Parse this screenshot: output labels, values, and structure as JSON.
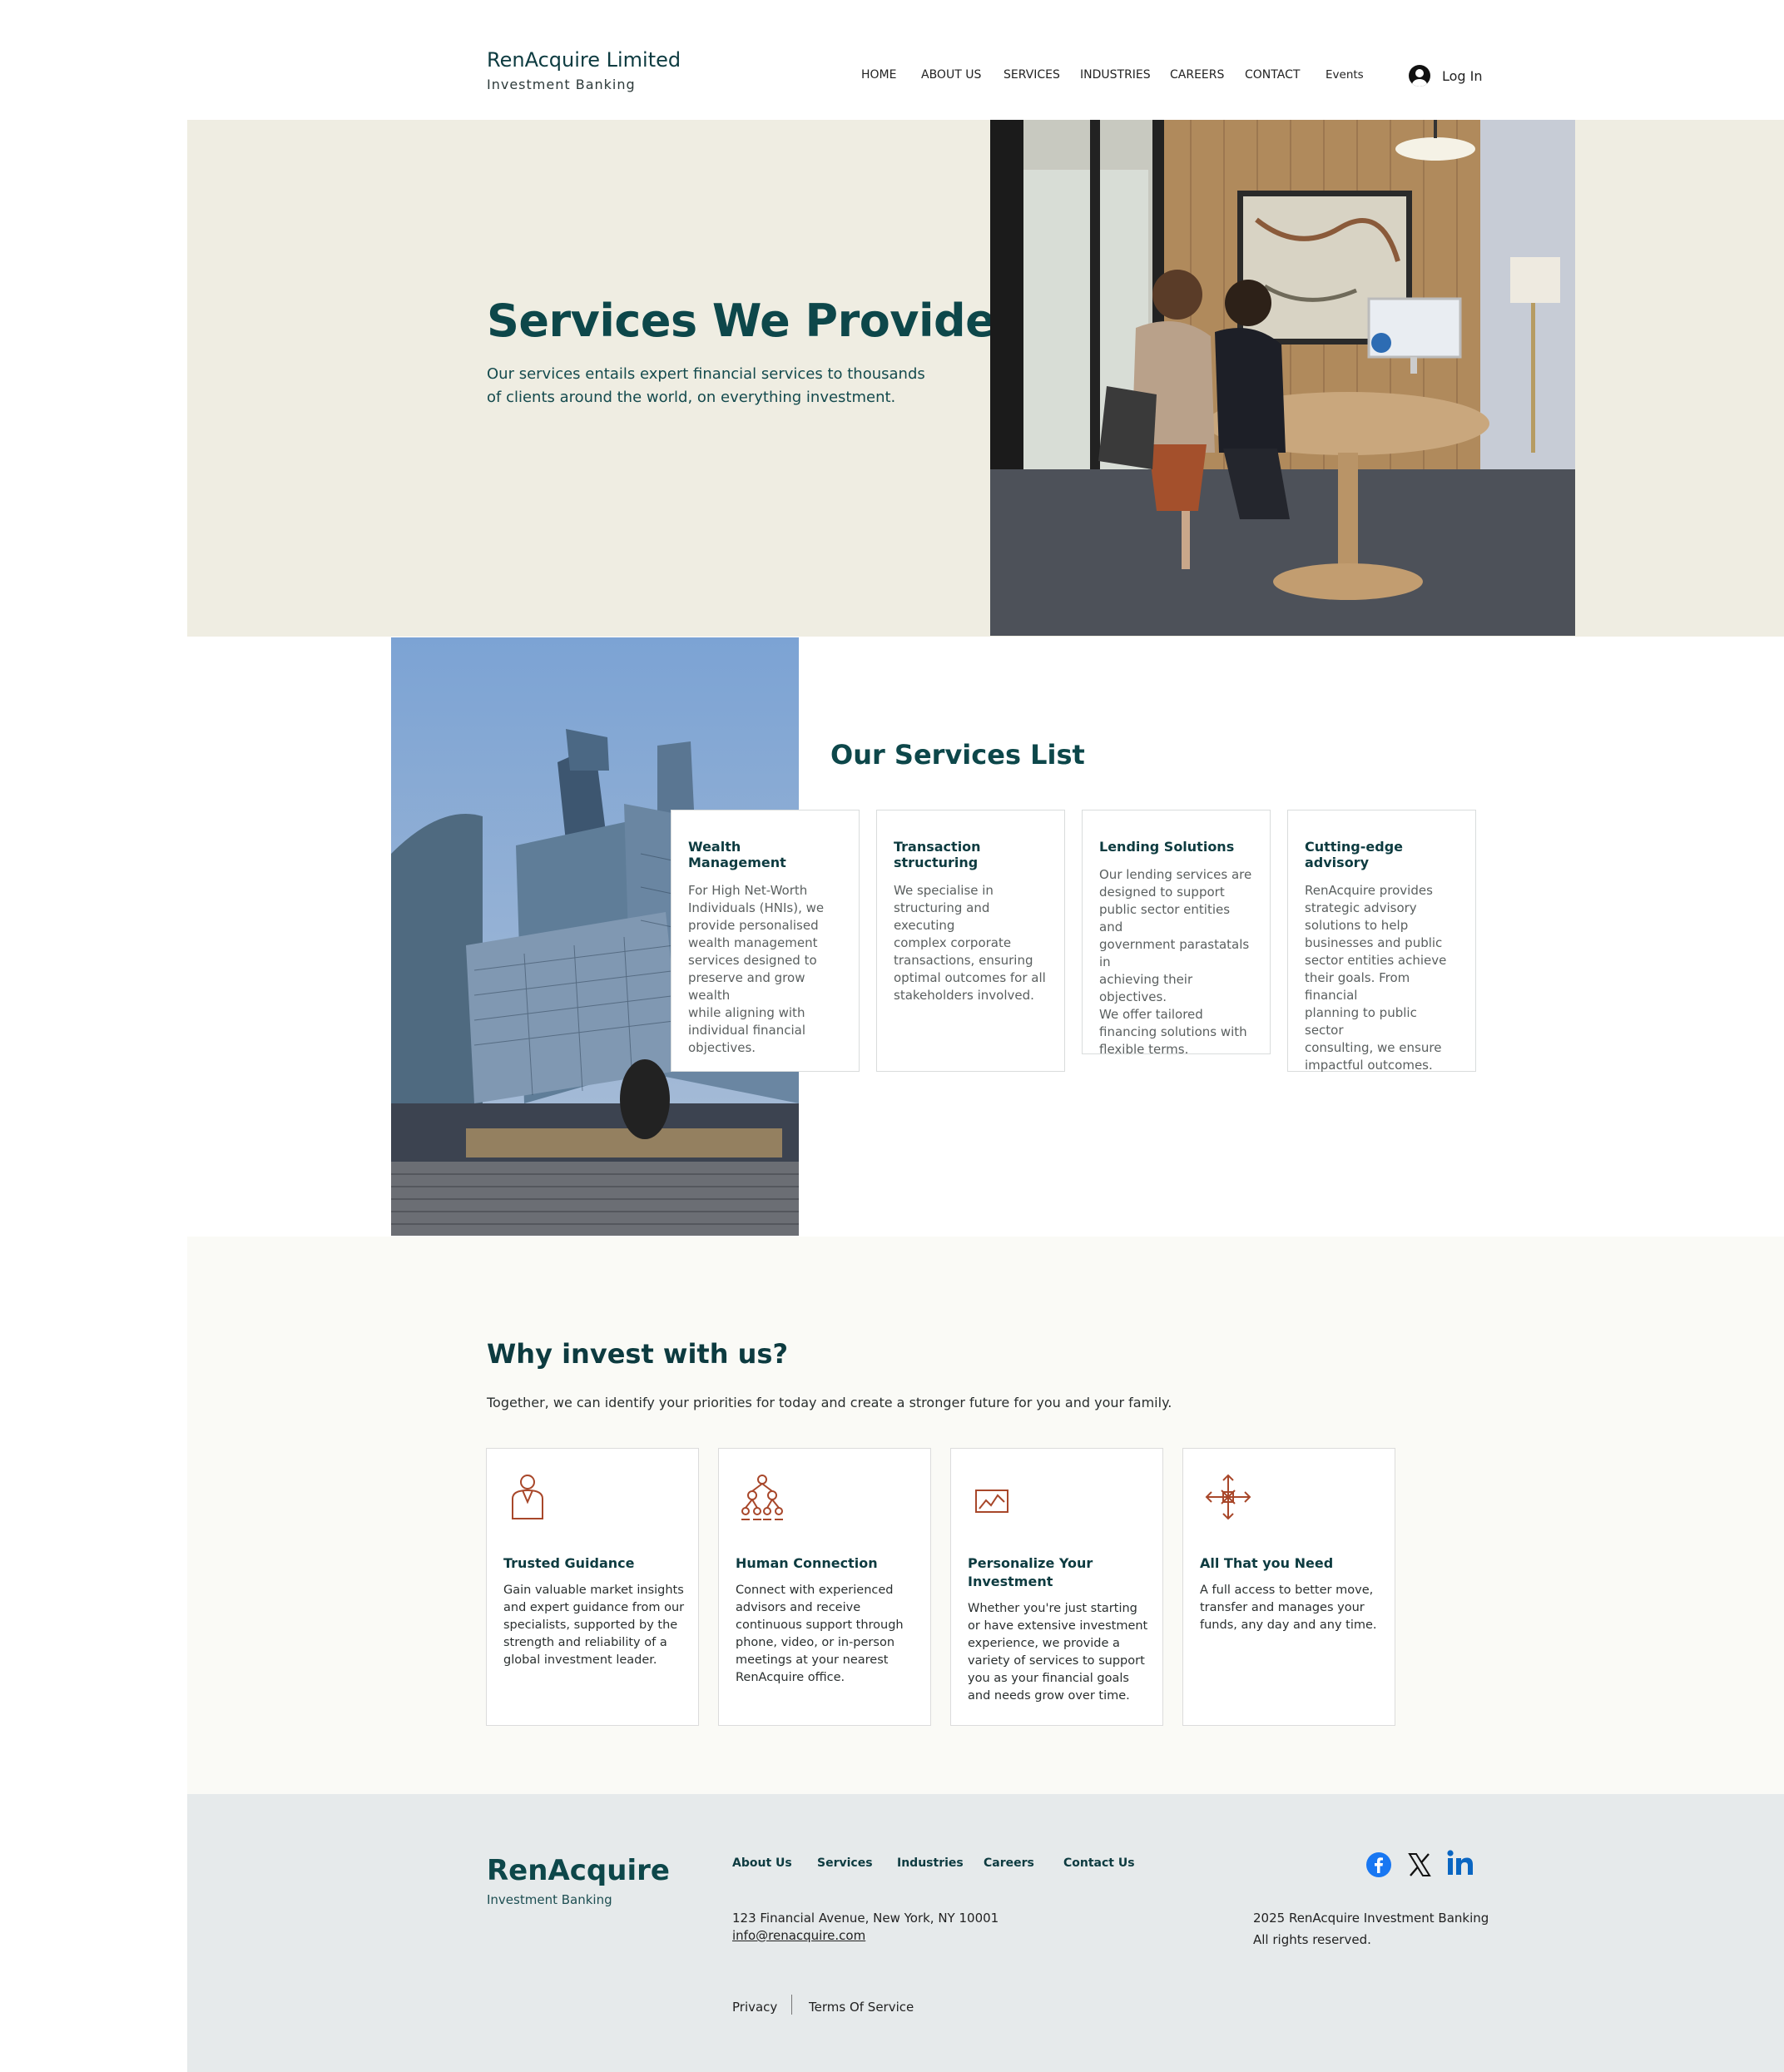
{
  "header": {
    "brand_name": "RenAcquire Limited",
    "brand_tagline": "Investment Banking",
    "nav": [
      "HOME",
      "ABOUT US",
      "SERVICES",
      "INDUSTRIES",
      "CAREERS",
      "CONTACT",
      "Events"
    ],
    "login_label": "Log In"
  },
  "hero": {
    "title": "Services We Provide",
    "text": "Our services entails expert financial services to thousands of clients around the world, on everything investment."
  },
  "services": {
    "title": "Our Services List",
    "cards": [
      {
        "title": "Wealth Management",
        "text": "For High Net-Worth\nIndividuals (HNIs), we\nprovide personalised\nwealth management\nservices designed to\npreserve and grow\nwealth\nwhile aligning with\nindividual financial\nobjectives."
      },
      {
        "title": "Transaction structuring",
        "text": "We specialise in\nstructuring and\nexecuting\ncomplex corporate\ntransactions, ensuring\noptimal outcomes for all\nstakeholders involved."
      },
      {
        "title": "Lending Solutions",
        "text": "Our lending services are\ndesigned to support\npublic sector entities and\ngovernment parastatals in\nachieving their objectives.\nWe offer tailored\nfinancing solutions with\nflexible terms."
      },
      {
        "title": "Cutting-edge advisory",
        "text": "RenAcquire provides\nstrategic advisory\nsolutions to help\nbusinesses and public\nsector entities achieve\ntheir goals. From\nfinancial\nplanning to public sector\nconsulting, we ensure\nimpactful outcomes."
      }
    ]
  },
  "why": {
    "title": "Why invest with us?",
    "text": "Together, we can identify your priorities for today and create a stronger future for you and your family.",
    "accent_color": "#a8472a",
    "cards": [
      {
        "icon": "person-icon",
        "title": "Trusted Guidance",
        "text": "Gain valuable market insights and expert guidance from our specialists, supported by the strength and reliability of a global investment leader."
      },
      {
        "icon": "network-icon",
        "title": "Human Connection",
        "text": "Connect with experienced advisors and receive continuous support through phone, video, or in-person meetings at your nearest RenAcquire office."
      },
      {
        "icon": "chart-icon",
        "title": "Personalize Your Investment",
        "text": "Whether you're just starting or have extensive investment experience, we provide a variety of services to support you as your financial goals and needs grow over time."
      },
      {
        "icon": "arrows-icon",
        "title": "All That you Need",
        "text": "A full access to better move, transfer and manages your funds, any day and any time."
      }
    ]
  },
  "footer": {
    "brand": "RenAcquire",
    "tagline": "Investment Banking",
    "links": [
      "About Us",
      "Services",
      "Industries",
      "Careers",
      "Contact Us"
    ],
    "address": "123 Financial Avenue, New York, NY 10001",
    "email": "info@renacquire.com",
    "copyright": "2025 RenAcquire Investment Banking\nAll rights reserved.",
    "privacy": "Privacy",
    "terms": "Terms Of Service",
    "social": [
      "facebook-icon",
      "x-icon",
      "linkedin-icon"
    ]
  }
}
